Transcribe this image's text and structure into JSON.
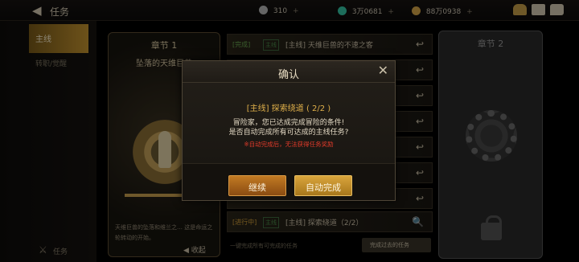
{
  "topbar": {
    "back_glyph": "◀",
    "title": "任务",
    "currencies": [
      {
        "value": "310",
        "plus": "+",
        "color": "#b9b9b9"
      },
      {
        "value": "3万0681",
        "plus": "+",
        "color": "#36c6a6"
      },
      {
        "value": "88万0938",
        "plus": "+",
        "color": "#d9a84a"
      }
    ]
  },
  "sidebar": {
    "active_label": "主线",
    "item_label": "转职/觉醒",
    "bottom_label": "任务",
    "bottom_icon": "⚔"
  },
  "chapter1": {
    "title": "章节 1",
    "caption": "坠落的天维巨兽",
    "progress": 0.72,
    "description": "天维巨兽的坠落和维兰之… 这是命运之轮转动的开始。",
    "collapse_label": "◀ 收起"
  },
  "chapter2": {
    "title": "章节 2"
  },
  "quests": [
    {
      "status": "[完成]",
      "tag": "主线",
      "name": "[主线] 天维巨兽的不速之客",
      "action": "↩"
    },
    {
      "status": "",
      "tag": "",
      "name": "",
      "action": "↩"
    },
    {
      "status": "",
      "tag": "",
      "name": "",
      "action": "↩"
    },
    {
      "status": "",
      "tag": "",
      "name": "",
      "action": "↩"
    },
    {
      "status": "",
      "tag": "",
      "name": "",
      "action": "↩"
    },
    {
      "status": "",
      "tag": "",
      "name": "",
      "action": "↩"
    },
    {
      "status": "",
      "tag": "",
      "name": "",
      "action": "↩"
    },
    {
      "status": "[进行中]",
      "tag": "主线",
      "name": "[主线] 探索绕道（2/2）",
      "action": "🔍"
    }
  ],
  "footer": {
    "note": "一键完成所有可完成的任务",
    "button": "完成过去的任务"
  },
  "dialog": {
    "title": "确认",
    "close_glyph": "✕",
    "quest_title": "[主线] 探索绕道 ( 2/2 )",
    "line1": "冒险家，您已达成完成冒险的条件!",
    "line2": "是否自动完成所有可达成的主线任务?",
    "warning": "※自动完成后，无法获得任务奖励",
    "continue_label": "继续",
    "auto_label": "自动完成"
  },
  "colors": {
    "accent_gold": "#e0b04a",
    "warning_red": "#e03a2a",
    "continue_orange": "#c27a23"
  }
}
